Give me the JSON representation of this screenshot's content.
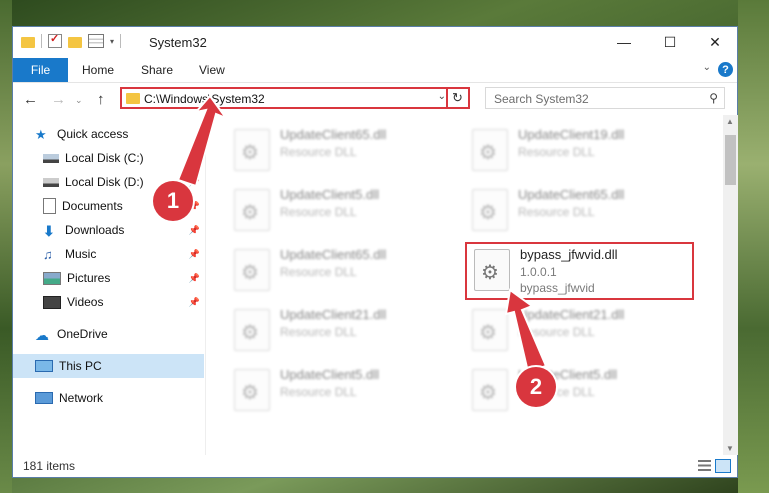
{
  "window": {
    "title": "System32"
  },
  "ribbon": {
    "file": "File",
    "home": "Home",
    "share": "Share",
    "view": "View"
  },
  "address": {
    "path": "C:\\Windows\\System32"
  },
  "search": {
    "placeholder": "Search System32"
  },
  "nav": {
    "quick_access": "Quick access",
    "items": [
      "Local Disk (C:)",
      "Local Disk (D:)",
      "Documents",
      "Downloads",
      "Music",
      "Pictures",
      "Videos"
    ],
    "onedrive": "OneDrive",
    "this_pc": "This PC",
    "network": "Network"
  },
  "files": [
    {
      "name": "UpdateClient65.dll",
      "type": "Resource DLL"
    },
    {
      "name": "UpdateClient19.dll",
      "type": "Resource DLL"
    },
    {
      "name": "UpdateClient5.dll",
      "type": "Resource DLL"
    },
    {
      "name": "UpdateClient65.dll",
      "type": "Resource DLL"
    },
    {
      "name": "UpdateClient65.dll",
      "type": "Resource DLL"
    },
    {
      "name": "bypass_jfwvid.dll",
      "version": "1.0.0.1",
      "description": "bypass_jfwvid"
    },
    {
      "name": "UpdateClient21.dll",
      "type": "Resource DLL"
    },
    {
      "name": "UpdateClient21.dll",
      "type": "Resource DLL"
    },
    {
      "name": "UpdateClient5.dll",
      "type": "Resource DLL"
    },
    {
      "name": "UpdateClient5.dll",
      "type": "Resource DLL"
    }
  ],
  "status": {
    "items": "181 items"
  },
  "annotations": [
    "1",
    "2"
  ],
  "colors": {
    "accent": "#1979ca",
    "highlight": "#d9363e",
    "selected": "#cce4f7"
  },
  "icons": [
    "folder-icon",
    "check-icon",
    "properties-icon",
    "back-icon",
    "forward-icon",
    "up-icon",
    "refresh-icon",
    "search-icon",
    "star-icon",
    "drive-icon",
    "documents-icon",
    "downloads-icon",
    "music-icon",
    "pictures-icon",
    "videos-icon",
    "onedrive-icon",
    "pc-icon",
    "network-icon",
    "pin-icon",
    "dll-icon",
    "help-icon"
  ]
}
